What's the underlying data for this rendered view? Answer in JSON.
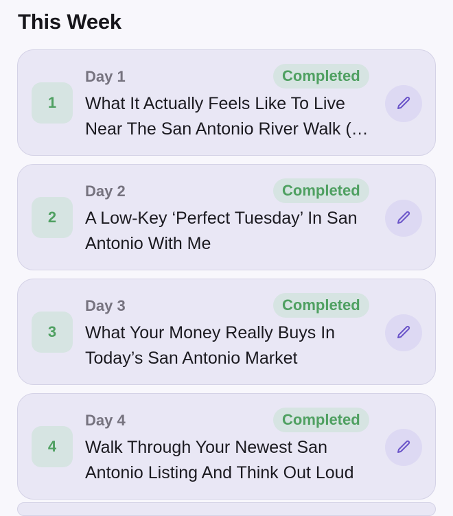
{
  "section": {
    "title": "This Week"
  },
  "days": [
    {
      "number": "1",
      "day_label": "Day 1",
      "status": "Completed",
      "title": "What It Actually Feels Like To Live Near The San Antonio River Walk (A Local’s Perspective)"
    },
    {
      "number": "2",
      "day_label": "Day 2",
      "status": "Completed",
      "title": "A Low-Key ‘Perfect Tuesday’ In San Antonio With Me"
    },
    {
      "number": "3",
      "day_label": "Day 3",
      "status": "Completed",
      "title": "What Your Money Really Buys In Today’s San Antonio Market"
    },
    {
      "number": "4",
      "day_label": "Day 4",
      "status": "Completed",
      "title": "Walk Through Your Newest San Antonio Listing And Think Out Loud"
    }
  ],
  "icons": {
    "edit": "pencil-icon"
  },
  "colors": {
    "status_green": "#4fa061",
    "badge_bg": "#d6e4e2",
    "card_bg": "#e9e7f5",
    "edit_accent": "#6b55c9"
  }
}
